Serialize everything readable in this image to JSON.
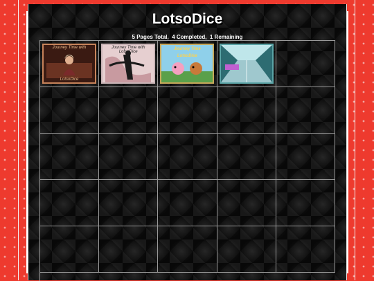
{
  "site": {
    "title": "LotsoDice",
    "stats": "5 Pages Total,  4 Completed,  1 Remaining"
  },
  "thumbnails": [
    {
      "caption_top": "Journey Time with",
      "caption_bottom": "LotsoDice",
      "colors": {
        "bg": "#3a1a12",
        "accent": "#e8a070"
      }
    },
    {
      "caption_top": "Journey Time with LotsoDice",
      "caption_bottom": "",
      "colors": {
        "bg": "#e0c6c8",
        "accent": "#1a1a1a"
      }
    },
    {
      "caption_top": "Journey Time",
      "caption_bottom": "LotsoDice",
      "colors": {
        "bg": "#5aa04a",
        "accent": "#ffd24a"
      }
    },
    {
      "caption_top": "",
      "caption_bottom": "",
      "colors": {
        "bg": "#2d6c72",
        "accent": "#c060d0"
      }
    }
  ],
  "grid": {
    "columns": 5,
    "rows": 5
  }
}
